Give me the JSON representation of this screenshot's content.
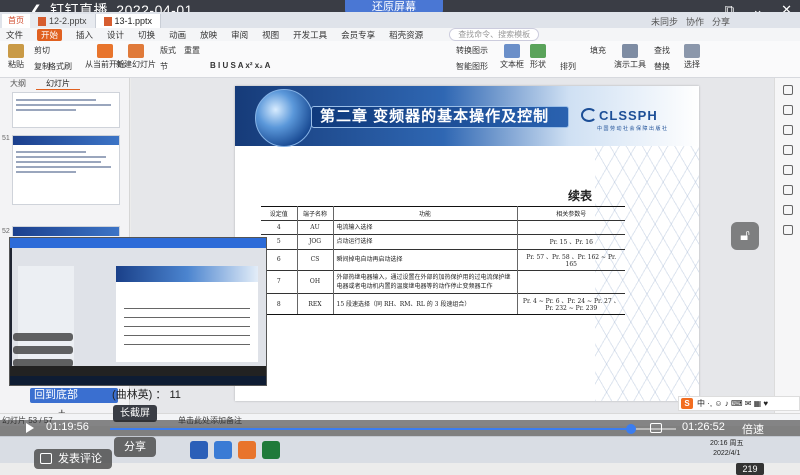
{
  "live": {
    "title": "钉钉直播_2022-04-01",
    "restore_label": "还原屏幕"
  },
  "tabs": {
    "home": "首页",
    "doc1": "12-2.pptx",
    "doc2": "13-1.pptx",
    "right": [
      "未同步",
      "协作",
      "分享"
    ]
  },
  "menu": {
    "items": [
      "文件",
      "插入",
      "设计",
      "切换",
      "动画",
      "放映",
      "审阅",
      "视图",
      "开发工具",
      "会员专享",
      "稻壳资源"
    ],
    "start": "开始",
    "search_placeholder": "查找命令、搜索模板"
  },
  "ribbon": {
    "paste": "粘贴",
    "cut": "剪切",
    "copy": "复制",
    "format": "格式刷",
    "from_start": "从当前开始",
    "new_slide": "新建幻灯片",
    "layout": "版式",
    "section": "节",
    "reset": "重置",
    "text_box": "文本框",
    "shape": "形状",
    "arrange": "排列",
    "fill": "填充",
    "find": "查找",
    "replace": "替换",
    "select": "选择",
    "presenter": "演示工具",
    "smart_shape": "智能图形",
    "convert": "转换图示"
  },
  "left_panel": {
    "tab_outline": "大纲",
    "tab_slides": "幻灯片",
    "slide_numbers": [
      "",
      "51",
      "52"
    ]
  },
  "slide": {
    "chapter_title": "第二章 变频器的基本操作及控制",
    "logo": "CLSSPH",
    "logo_sub": "中国劳动社会保障出版社",
    "continued": "续表",
    "table_headers": [
      "设定值",
      "端子名称",
      "功能",
      "相关参数号"
    ],
    "table_rows": [
      [
        "4",
        "AU",
        "电流输入选择",
        ""
      ],
      [
        "5",
        "JOG",
        "点动运行选择",
        "Pr. 15 、Pr. 16"
      ],
      [
        "6",
        "CS",
        "瞬间掉电自动再启动选择",
        "Pr. 57 、Pr. 58 、Pr. 162 ~ Pr. 165"
      ],
      [
        "7",
        "OH",
        "外部热继电器输入，通过设置在外部的加热保护用的过电流保护继电器或者电动机内置的温度继电器等的动作停止变频器工作",
        ""
      ],
      [
        "8",
        "REX",
        "15 段速选择（同 RH、RM、RL 的 3 段速组合）",
        "Pr. 4 ~ Pr. 6 、Pr. 24 ~ Pr. 27 、Pr. 232 ~ Pr. 239"
      ]
    ]
  },
  "overlay": {
    "back_to_bottom": "回到底部",
    "online_text": "(曲林英) ：  11",
    "long_screenshot": "长截屏",
    "note_hint": "单击此处添加备注",
    "share": "分享",
    "comment": "发表评论",
    "viewers": "219"
  },
  "status": {
    "slide_no": "幻灯片 53 / 57"
  },
  "player": {
    "current_time": "01:19:56",
    "total_time": "01:26:52",
    "speed": "倍速",
    "progress": 0.92
  },
  "taskbar": {
    "time": "20:16 周五",
    "date": "2022/4/1"
  },
  "ime": {
    "label": "S"
  }
}
